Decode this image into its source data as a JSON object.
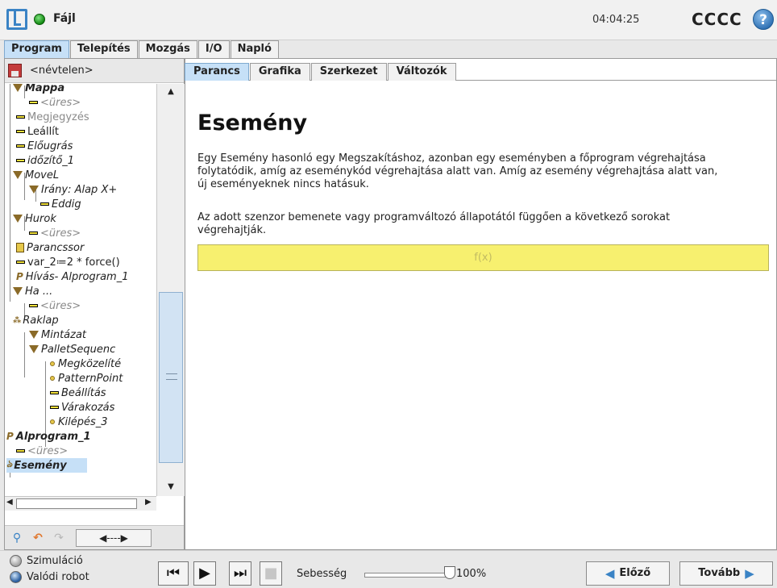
{
  "header": {
    "file_label": "Fájl",
    "clock": "04:04:25",
    "robot_name": "CCCC",
    "help_label": "?"
  },
  "main_tabs": [
    {
      "label": "Program",
      "active": true
    },
    {
      "label": "Telepítés",
      "active": false
    },
    {
      "label": "Mozgás",
      "active": false
    },
    {
      "label": "I/O",
      "active": false
    },
    {
      "label": "Napló",
      "active": false
    }
  ],
  "program": {
    "name": "<névtelen>"
  },
  "tree": [
    {
      "label": "Mappa",
      "style": "bold-italic",
      "icon": "folder-triangle-icon"
    },
    {
      "label": "<üres>",
      "style": "gray-italic",
      "icon": "empty-bar-icon"
    },
    {
      "label": "Megjegyzés",
      "style": "gray",
      "icon": "comment-bar-icon"
    },
    {
      "label": "Leállít",
      "style": "normal",
      "icon": "halt-bar-icon"
    },
    {
      "label": "Előugrás",
      "style": "italic",
      "icon": "popup-bar-icon"
    },
    {
      "label": "időzítő_1",
      "style": "italic",
      "icon": "timer-bar-icon"
    },
    {
      "label": "MoveL",
      "style": "italic",
      "icon": "movel-triangle-icon"
    },
    {
      "label": "Irány: Alap X+",
      "style": "italic",
      "icon": "direction-triangle-icon"
    },
    {
      "label": "Eddig",
      "style": "italic",
      "icon": "until-bar-icon"
    },
    {
      "label": "Hurok",
      "style": "italic",
      "icon": "loop-triangle-icon"
    },
    {
      "label": "<üres>",
      "style": "gray-italic",
      "icon": "empty-bar-icon"
    },
    {
      "label": "Parancssor",
      "style": "italic",
      "icon": "script-icon"
    },
    {
      "label": "var_2≔2 * force()",
      "style": "normal",
      "icon": "assignment-bar-icon"
    },
    {
      "label": "Hívás- Alprogram_1",
      "style": "italic",
      "icon": "subprogram-p-icon"
    },
    {
      "label": "Ha ...",
      "style": "italic",
      "icon": "if-triangle-icon"
    },
    {
      "label": "<üres>",
      "style": "gray-italic",
      "icon": "empty-bar-icon"
    },
    {
      "label": "Raklap",
      "style": "italic",
      "icon": "pallet-icon"
    },
    {
      "label": "Mintázat",
      "style": "italic",
      "icon": "pattern-triangle-icon"
    },
    {
      "label": "PalletSequenc",
      "style": "italic",
      "icon": "sequence-triangle-icon"
    },
    {
      "label": "Megközelíté",
      "style": "italic",
      "icon": "waypoint-dot-icon"
    },
    {
      "label": "PatternPoint",
      "style": "italic",
      "icon": "waypoint-dot-icon"
    },
    {
      "label": "Beállítás",
      "style": "italic",
      "icon": "set-bar-icon"
    },
    {
      "label": "Várakozás",
      "style": "italic",
      "icon": "wait-bar-icon"
    },
    {
      "label": "Kilépés_3",
      "style": "italic",
      "icon": "waypoint-dot-icon"
    },
    {
      "label": "Alprogram_1",
      "style": "bold-italic",
      "icon": "subprogram-p-icon"
    },
    {
      "label": "<üres>",
      "style": "gray-italic",
      "icon": "empty-bar-icon"
    },
    {
      "label": "Esemény",
      "style": "bold-italic-selected",
      "icon": "event-icon"
    }
  ],
  "sub_tabs": [
    {
      "label": "Parancs",
      "active": true
    },
    {
      "label": "Grafika",
      "active": false
    },
    {
      "label": "Szerkezet",
      "active": false
    },
    {
      "label": "Változók",
      "active": false
    }
  ],
  "command": {
    "title": "Esemény",
    "description": "Egy Esemény hasonló egy Megszakításhoz, azonban egy eseményben a főprogram végrehajtása folytatódik, amíg az eseménykód végrehajtása alatt van. Amíg az esemény végrehajtása alatt van, új eseményeknek nincs hatásuk.",
    "description2": "Az adott szenzor bemenete vagy programváltozó állapotától függően a következő sorokat végrehajtják.",
    "expression_placeholder": "f(x)"
  },
  "tools": {
    "move_label": "◀----▶"
  },
  "footer": {
    "mode_sim": "Szimuláció",
    "mode_real": "Valódi robot",
    "selected_mode": "Valódi robot",
    "speed_label": "Sebesség",
    "speed_value": "100%",
    "speed_fraction": 1.0,
    "prev_label": "Előző",
    "next_label": "Tovább"
  },
  "colors": {
    "active_tab": "#c6e0f7",
    "expression_box": "#f7f06f",
    "accent_blue": "#3a83c5"
  }
}
